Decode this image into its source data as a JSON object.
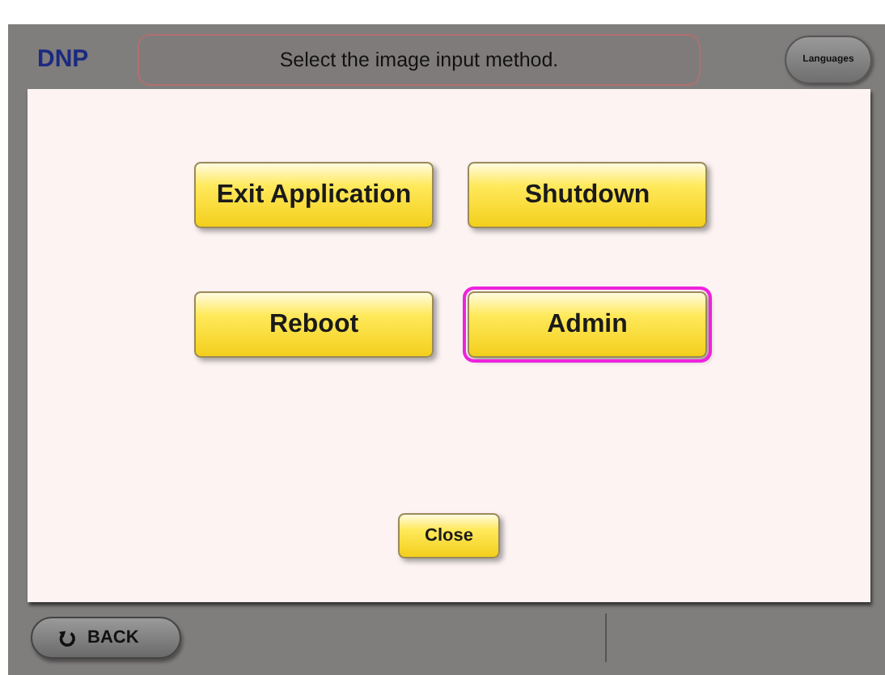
{
  "header": {
    "logo": "DNP",
    "title": "Select the image input method.",
    "languages_button": "Languages"
  },
  "menu_buttons": [
    {
      "label": "Exit Application",
      "selected": false
    },
    {
      "label": "Shutdown",
      "selected": false
    },
    {
      "label": "Reboot",
      "selected": false
    },
    {
      "label": "Admin",
      "selected": true
    }
  ],
  "close_button": "Close",
  "back_button": "BACK"
}
